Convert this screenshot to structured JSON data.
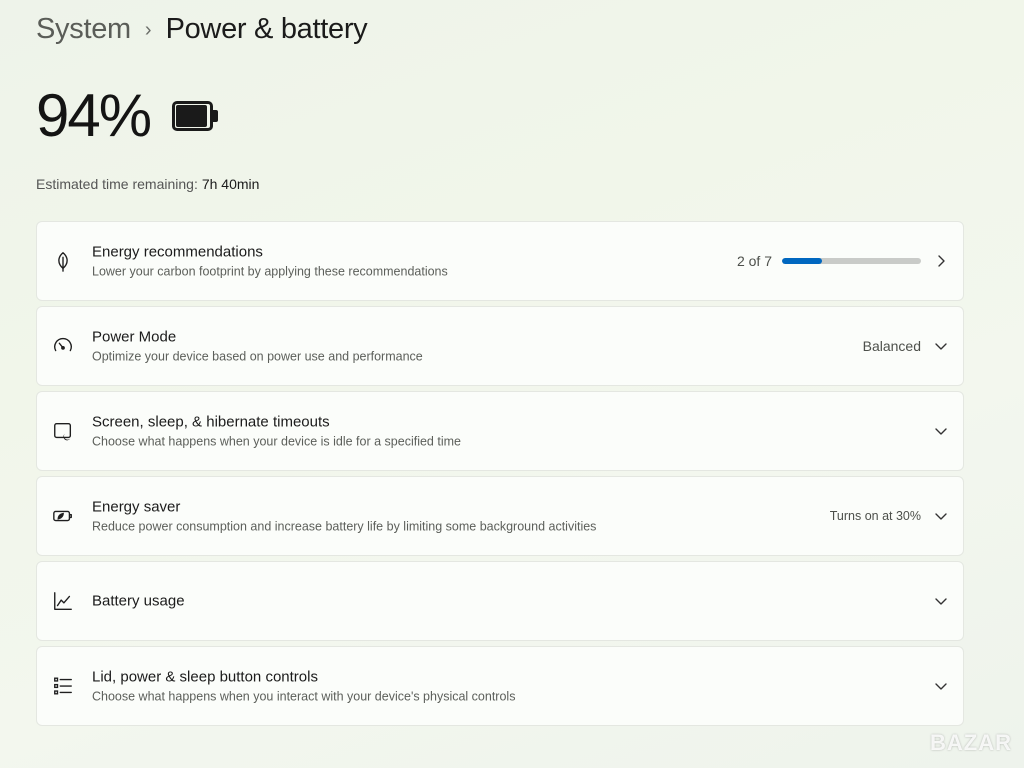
{
  "breadcrumb": {
    "parent": "System",
    "separator": "›",
    "current": "Power & battery"
  },
  "battery": {
    "percent_label": "94%",
    "level": 0.94
  },
  "estimate": {
    "label": "Estimated time remaining:",
    "value": "7h 40min"
  },
  "cards": {
    "energy_recommendations": {
      "title": "Energy recommendations",
      "desc": "Lower your carbon footprint by applying these recommendations",
      "progress_label": "2 of 7",
      "progress_done": 2,
      "progress_total": 7,
      "icon": "leaf-icon"
    },
    "power_mode": {
      "title": "Power Mode",
      "desc": "Optimize your device based on power use and performance",
      "value": "Balanced",
      "icon": "power-mode-gauge-icon"
    },
    "screen_sleep": {
      "title": "Screen, sleep, & hibernate timeouts",
      "desc": "Choose what happens when your device is idle for a specified time",
      "icon": "screen-sleep-icon"
    },
    "energy_saver": {
      "title": "Energy saver",
      "desc": "Reduce power consumption and increase battery life by limiting some background activities",
      "value": "Turns on at 30%",
      "icon": "energy-saver-icon"
    },
    "battery_usage": {
      "title": "Battery usage",
      "icon": "line-chart-icon"
    },
    "lid_controls": {
      "title": "Lid, power & sleep button controls",
      "desc": "Choose what happens when you interact with your device's physical controls",
      "icon": "list-settings-icon"
    }
  },
  "colors": {
    "accent": "#0067c0",
    "progress_track": "#c9cbc8"
  },
  "watermark": "BAZAR"
}
